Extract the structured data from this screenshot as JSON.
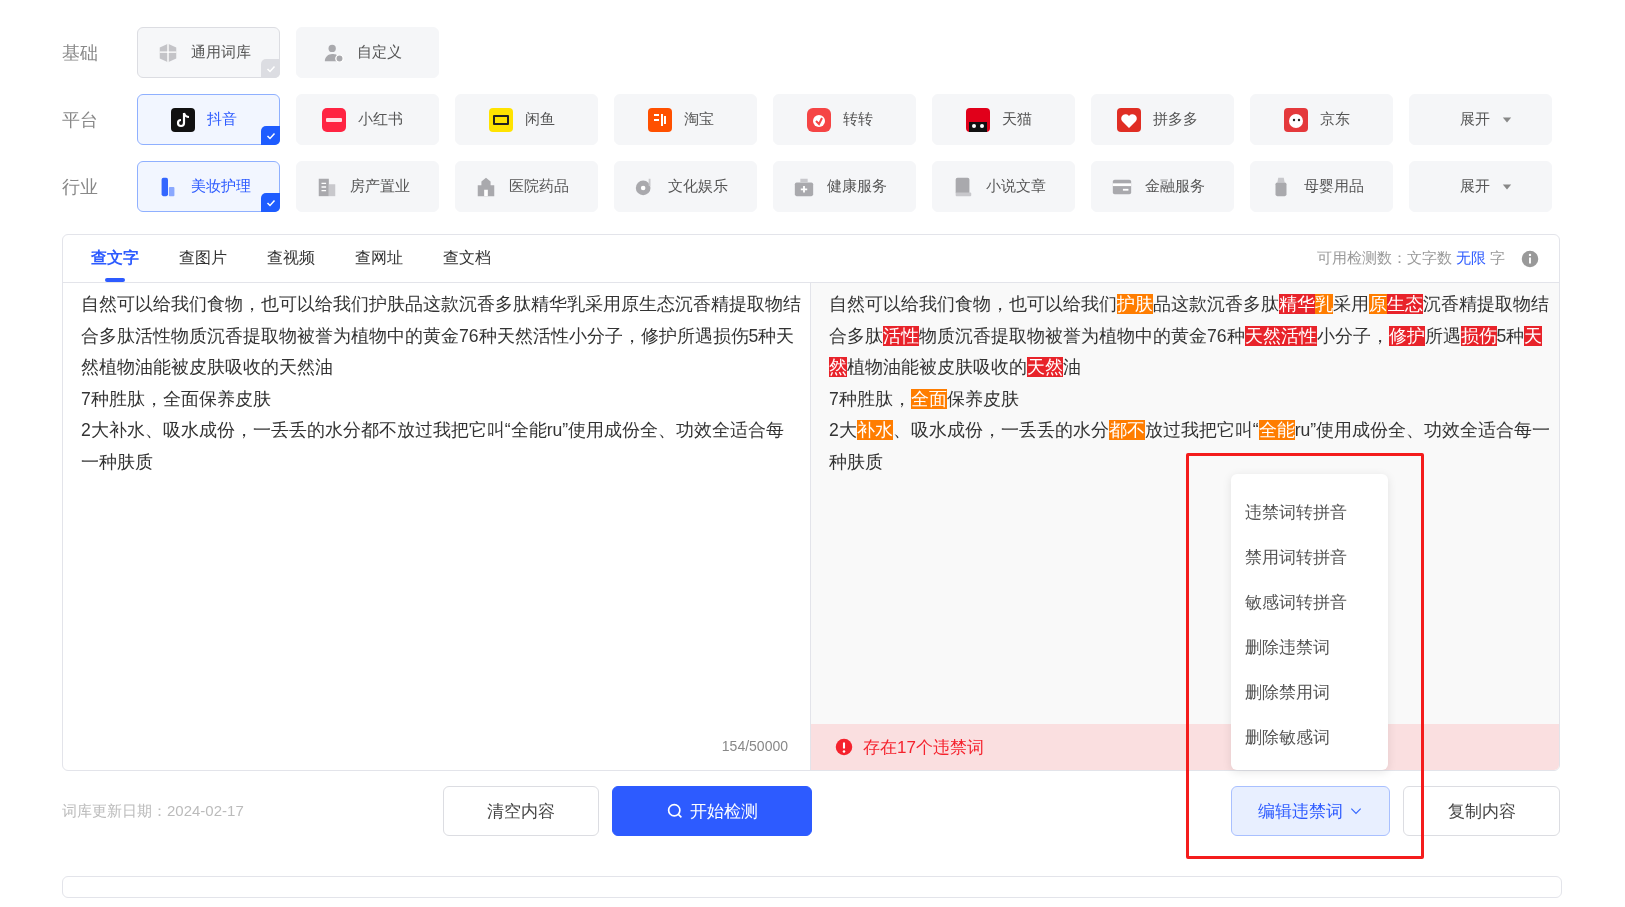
{
  "filters": [
    {
      "label": "基础",
      "options": [
        {
          "label": "通用词库",
          "selected": true,
          "disabled": true
        },
        {
          "label": "自定义",
          "selected": false,
          "disabled": false
        }
      ]
    },
    {
      "label": "平台",
      "options": [
        {
          "label": "抖音",
          "selected": true,
          "disabled": false
        },
        {
          "label": "小红书",
          "selected": false,
          "disabled": false
        },
        {
          "label": "闲鱼",
          "selected": false,
          "disabled": false
        },
        {
          "label": "淘宝",
          "selected": false,
          "disabled": false
        },
        {
          "label": "转转",
          "selected": false,
          "disabled": false
        },
        {
          "label": "天猫",
          "selected": false,
          "disabled": false
        },
        {
          "label": "拼多多",
          "selected": false,
          "disabled": false
        },
        {
          "label": "京东",
          "selected": false,
          "disabled": false
        }
      ],
      "expand": "展开"
    },
    {
      "label": "行业",
      "options": [
        {
          "label": "美妆护理",
          "selected": true,
          "disabled": false
        },
        {
          "label": "房产置业",
          "selected": false,
          "disabled": false
        },
        {
          "label": "医院药品",
          "selected": false,
          "disabled": false
        },
        {
          "label": "文化娱乐",
          "selected": false,
          "disabled": false
        },
        {
          "label": "健康服务",
          "selected": false,
          "disabled": false
        },
        {
          "label": "小说文章",
          "selected": false,
          "disabled": false
        },
        {
          "label": "金融服务",
          "selected": false,
          "disabled": false
        },
        {
          "label": "母婴用品",
          "selected": false,
          "disabled": false
        }
      ],
      "expand": "展开"
    }
  ],
  "tabs": [
    {
      "label": "查文字",
      "selected": true
    },
    {
      "label": "查图片",
      "selected": false
    },
    {
      "label": "查视频",
      "selected": false
    },
    {
      "label": "查网址",
      "selected": false
    },
    {
      "label": "查文档",
      "selected": false
    }
  ],
  "quota": {
    "label": "可用检测数：文字数",
    "value": "无限",
    "unit": "字"
  },
  "input": {
    "paragraphs": [
      "自然可以给我们食物，也可以给我们护肤品这款沉香多肽精华乳采用原生态沉香精提取物结合多肽活性物质沉香提取物被誉为植物中的黄金76种天然活性小分子，修护所遇损伤5种天然植物油能被皮肤吸收的天然油",
      "7种胜肽，全面保养皮肤",
      "2大补水、吸水成份，一丢丢的水分都不放过我把它叫“全能ru”使用成份全、功效全适合每一种肤质"
    ],
    "counter": "154/50000"
  },
  "result": {
    "paragraphs": [
      [
        {
          "text": "自然可以给我们食物，也可以给我们",
          "kind": "plain"
        },
        {
          "text": "护肤",
          "kind": "sensitive"
        },
        {
          "text": "品这款沉香多肽",
          "kind": "plain"
        },
        {
          "text": "精华",
          "kind": "banned"
        },
        {
          "text": "乳",
          "kind": "sensitive"
        },
        {
          "text": "采用",
          "kind": "plain"
        },
        {
          "text": "原",
          "kind": "sensitive"
        },
        {
          "text": "生态",
          "kind": "banned"
        },
        {
          "text": "沉香精提取物结合多肽",
          "kind": "plain"
        },
        {
          "text": "活性",
          "kind": "banned"
        },
        {
          "text": "物质沉香提取物被誉为植物中的黄金76种",
          "kind": "plain"
        },
        {
          "text": "天然活性",
          "kind": "banned"
        },
        {
          "text": "小分子，",
          "kind": "plain"
        },
        {
          "text": "修护",
          "kind": "banned"
        },
        {
          "text": "所遇",
          "kind": "plain"
        },
        {
          "text": "损伤",
          "kind": "banned"
        },
        {
          "text": "5种",
          "kind": "plain"
        },
        {
          "text": "天然",
          "kind": "banned"
        },
        {
          "text": "植物油能被皮肤吸收的",
          "kind": "plain"
        },
        {
          "text": "天然",
          "kind": "banned"
        },
        {
          "text": "油",
          "kind": "plain"
        }
      ],
      [
        {
          "text": "7种胜肽，",
          "kind": "plain"
        },
        {
          "text": "全面",
          "kind": "sensitive"
        },
        {
          "text": "保养皮肤",
          "kind": "plain"
        }
      ],
      [
        {
          "text": "2大",
          "kind": "plain"
        },
        {
          "text": "补水",
          "kind": "sensitive"
        },
        {
          "text": "、吸水成份，一丢丢的水分",
          "kind": "plain"
        },
        {
          "text": "都不",
          "kind": "sensitive"
        },
        {
          "text": "放过我把它叫“",
          "kind": "plain"
        },
        {
          "text": "全能",
          "kind": "sensitive"
        },
        {
          "text": "ru”使用成份全、功效全适合每一种肤质",
          "kind": "plain"
        }
      ]
    ],
    "alert": "存在17个违禁词"
  },
  "update_date": "词库更新日期：2024-02-17",
  "clear_button": "清空内容",
  "start_button": "开始检测",
  "edit_menu": {
    "label": "编辑违禁词",
    "expanded": true,
    "items": [
      "违禁词转拼音",
      "禁用词转拼音",
      "敏感词转拼音",
      "删除违禁词",
      "删除禁用词",
      "删除敏感词"
    ]
  },
  "copy_button": "复制内容",
  "annotation_frame": true
}
